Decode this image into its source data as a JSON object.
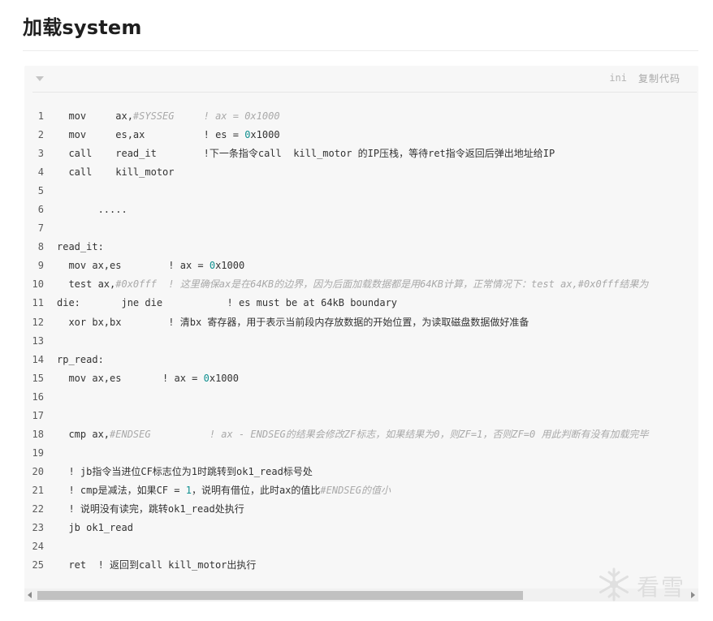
{
  "header": {
    "title": "加载system"
  },
  "code_block": {
    "language": "ini",
    "copy_label": "复制代码",
    "lines": [
      {
        "n": "1",
        "segs": [
          [
            "t",
            "  mov     ax,"
          ],
          [
            "c",
            "#SYSSEG     ! ax = 0x1000"
          ]
        ]
      },
      {
        "n": "2",
        "segs": [
          [
            "t",
            "  mov     es,ax          ! es = "
          ],
          [
            "n",
            "0"
          ],
          [
            "t",
            "x1000"
          ]
        ]
      },
      {
        "n": "3",
        "segs": [
          [
            "t",
            "  call    read_it        !下一条指令call  kill_motor 的IP压栈，等待ret指令返回后弹出地址给IP"
          ]
        ]
      },
      {
        "n": "4",
        "segs": [
          [
            "t",
            "  call    kill_motor"
          ]
        ]
      },
      {
        "n": "5",
        "segs": [
          [
            "t",
            ""
          ]
        ]
      },
      {
        "n": "6",
        "segs": [
          [
            "t",
            "       ....."
          ]
        ]
      },
      {
        "n": "7",
        "segs": [
          [
            "t",
            ""
          ]
        ]
      },
      {
        "n": "8",
        "segs": [
          [
            "t",
            "read_it:"
          ]
        ]
      },
      {
        "n": "9",
        "segs": [
          [
            "t",
            "  mov ax,es        ! ax = "
          ],
          [
            "n",
            "0"
          ],
          [
            "t",
            "x1000"
          ]
        ]
      },
      {
        "n": "10",
        "segs": [
          [
            "t",
            "  test ax,"
          ],
          [
            "c",
            "#0x0fff  ! 这里确保ax是在64KB的边界，因为后面加载数据都是用64KB计算，正常情况下：test ax,#0x0fff结果为"
          ]
        ]
      },
      {
        "n": "11",
        "segs": [
          [
            "t",
            "die:       jne die           ! es must be at 64kB boundary"
          ]
        ]
      },
      {
        "n": "12",
        "segs": [
          [
            "t",
            "  xor bx,bx        ! 清bx 寄存器，用于表示当前段内存放数据的开始位置，为读取磁盘数据做好准备"
          ]
        ]
      },
      {
        "n": "13",
        "segs": [
          [
            "t",
            ""
          ]
        ]
      },
      {
        "n": "14",
        "segs": [
          [
            "t",
            "rp_read:"
          ]
        ]
      },
      {
        "n": "15",
        "segs": [
          [
            "t",
            "  mov ax,es       ! ax = "
          ],
          [
            "n",
            "0"
          ],
          [
            "t",
            "x1000"
          ]
        ]
      },
      {
        "n": "16",
        "segs": [
          [
            "t",
            ""
          ]
        ]
      },
      {
        "n": "17",
        "segs": [
          [
            "t",
            ""
          ]
        ]
      },
      {
        "n": "18",
        "segs": [
          [
            "t",
            "  cmp ax,"
          ],
          [
            "c",
            "#ENDSEG          ! ax - ENDSEG的结果会修改ZF标志，如果结果为0，则ZF=1，否则ZF=0 用此判断有没有加载完毕"
          ]
        ]
      },
      {
        "n": "19",
        "segs": [
          [
            "t",
            ""
          ]
        ]
      },
      {
        "n": "20",
        "segs": [
          [
            "t",
            "  ! jb指令当进位CF标志位为1时跳转到ok1_read标号处"
          ]
        ]
      },
      {
        "n": "21",
        "segs": [
          [
            "t",
            "  ! cmp是减法，如果CF = "
          ],
          [
            "n",
            "1"
          ],
          [
            "t",
            "，说明有借位，此时ax的值比"
          ],
          [
            "c",
            "#ENDSEG的值小"
          ]
        ]
      },
      {
        "n": "22",
        "segs": [
          [
            "t",
            "  ! 说明没有读完，跳转ok1_read处执行"
          ]
        ]
      },
      {
        "n": "23",
        "segs": [
          [
            "t",
            "  jb ok1_read"
          ]
        ]
      },
      {
        "n": "24",
        "segs": [
          [
            "t",
            ""
          ]
        ]
      },
      {
        "n": "25",
        "segs": [
          [
            "t",
            "  ret  ! 返回到call kill_motor出执行"
          ]
        ]
      }
    ]
  },
  "watermark": {
    "text": "看雪"
  },
  "icons": {
    "collapse": "chevron-down-icon",
    "scroll_left": "arrow-left-icon",
    "scroll_right": "arrow-right-icon",
    "watermark_logo": "snowflake-icon"
  },
  "colors": {
    "number": "#0e8f8f",
    "comment": "#a9a9a9",
    "code_bg": "#f7f7f7"
  }
}
